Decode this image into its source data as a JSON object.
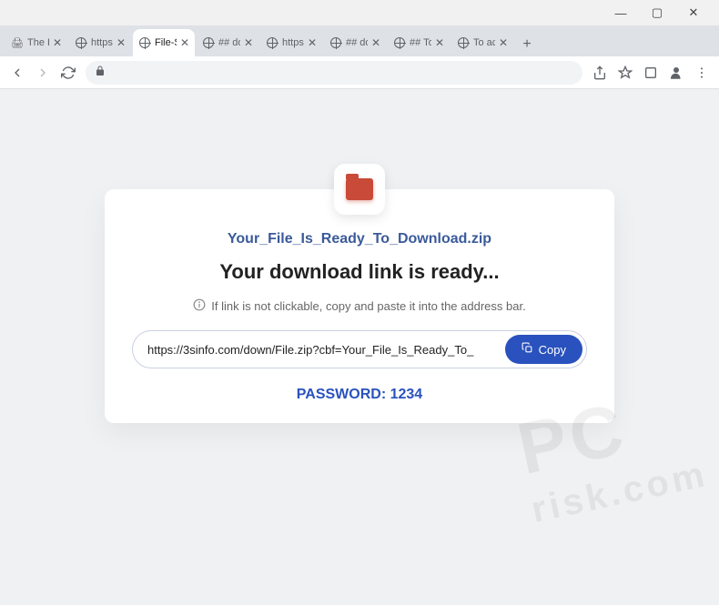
{
  "window": {
    "minimize": "—",
    "maximize": "▢",
    "close": "✕"
  },
  "tabs": [
    {
      "label": "The P",
      "icon": "printer"
    },
    {
      "label": "https:",
      "icon": "globe"
    },
    {
      "label": "File-Sl",
      "icon": "globe",
      "active": true
    },
    {
      "label": "## do",
      "icon": "globe"
    },
    {
      "label": "https:",
      "icon": "globe"
    },
    {
      "label": "## do",
      "icon": "globe"
    },
    {
      "label": "## To",
      "icon": "globe"
    },
    {
      "label": "To ac",
      "icon": "globe"
    }
  ],
  "newtab_label": "+",
  "addrbar": {
    "lock": "🔒"
  },
  "content": {
    "filename": "Your_File_Is_Ready_To_Download.zip",
    "ready_text": "Your download link is ready...",
    "hint_text": "If link is not clickable, copy and paste it into the address bar.",
    "download_url": "https://3sinfo.com/down/File.zip?cbf=Your_File_Is_Ready_To_",
    "copy_label": "Copy",
    "password_label": "PASSWORD: 1234"
  },
  "watermark": {
    "line1": "PC",
    "line2": "risk.com"
  }
}
